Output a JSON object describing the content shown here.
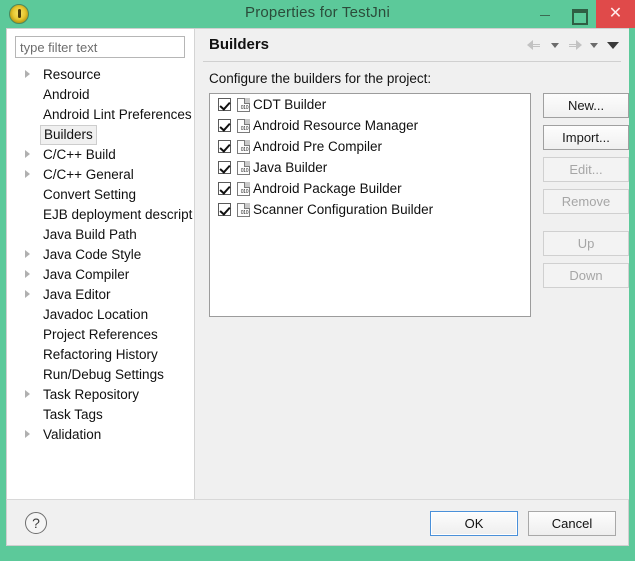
{
  "window": {
    "title": "Properties for TestJni",
    "app_icon": "eclipse-icon",
    "controls": {
      "minimize": "minimize-icon",
      "maximize": "maximize-icon",
      "close": "✕"
    },
    "titlebar_color": "#5cc99a",
    "close_button_color": "#e04a4a"
  },
  "sidebar": {
    "filter": {
      "placeholder": "type filter text",
      "value": ""
    },
    "items": [
      {
        "label": "Resource",
        "expandable": true,
        "selected": false
      },
      {
        "label": "Android",
        "expandable": false,
        "selected": false
      },
      {
        "label": "Android Lint Preferences",
        "expandable": false,
        "selected": false
      },
      {
        "label": "Builders",
        "expandable": false,
        "selected": true
      },
      {
        "label": "C/C++ Build",
        "expandable": true,
        "selected": false
      },
      {
        "label": "C/C++ General",
        "expandable": true,
        "selected": false
      },
      {
        "label": "Convert Setting",
        "expandable": false,
        "selected": false
      },
      {
        "label": "EJB deployment descript",
        "expandable": false,
        "selected": false
      },
      {
        "label": "Java Build Path",
        "expandable": false,
        "selected": false
      },
      {
        "label": "Java Code Style",
        "expandable": true,
        "selected": false
      },
      {
        "label": "Java Compiler",
        "expandable": true,
        "selected": false
      },
      {
        "label": "Java Editor",
        "expandable": true,
        "selected": false
      },
      {
        "label": "Javadoc Location",
        "expandable": false,
        "selected": false
      },
      {
        "label": "Project References",
        "expandable": false,
        "selected": false
      },
      {
        "label": "Refactoring History",
        "expandable": false,
        "selected": false
      },
      {
        "label": "Run/Debug Settings",
        "expandable": false,
        "selected": false
      },
      {
        "label": "Task Repository",
        "expandable": true,
        "selected": false
      },
      {
        "label": "Task Tags",
        "expandable": false,
        "selected": false
      },
      {
        "label": "Validation",
        "expandable": true,
        "selected": false
      }
    ],
    "scrollbar": {
      "left_arrow": "❮",
      "right_arrow": "❯"
    }
  },
  "page": {
    "title": "Builders",
    "description": "Configure the builders for the project:",
    "nav": {
      "back_icon": "arrow-left-icon",
      "back_menu_icon": "chevron-down-icon",
      "forward_icon": "arrow-right-icon",
      "forward_menu_icon": "chevron-down-icon",
      "view_menu_icon": "chevron-down-icon"
    },
    "builders": [
      {
        "name": "CDT Builder",
        "checked": true,
        "icon": "binary-file-icon"
      },
      {
        "name": "Android Resource Manager",
        "checked": true,
        "icon": "binary-file-icon"
      },
      {
        "name": "Android Pre Compiler",
        "checked": true,
        "icon": "binary-file-icon"
      },
      {
        "name": "Java Builder",
        "checked": true,
        "icon": "binary-file-icon"
      },
      {
        "name": "Android Package Builder",
        "checked": true,
        "icon": "binary-file-icon"
      },
      {
        "name": "Scanner Configuration Builder",
        "checked": true,
        "icon": "binary-file-icon"
      }
    ],
    "side_buttons": [
      {
        "label": "New...",
        "enabled": true
      },
      {
        "label": "Import...",
        "enabled": true
      },
      {
        "label": "Edit...",
        "enabled": false
      },
      {
        "label": "Remove",
        "enabled": false
      },
      {
        "label": "Up",
        "enabled": false
      },
      {
        "label": "Down",
        "enabled": false
      }
    ]
  },
  "footer": {
    "help_icon": "?",
    "ok_label": "OK",
    "cancel_label": "Cancel",
    "focus_color": "#4a90d9"
  }
}
